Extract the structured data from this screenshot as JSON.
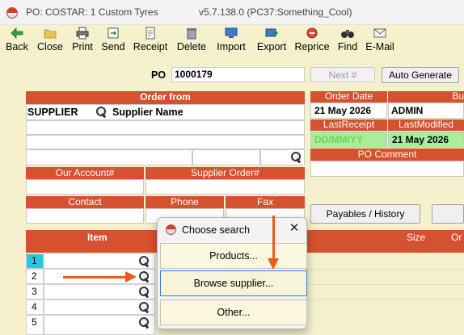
{
  "window": {
    "title": "PO: COSTAR:  1 Custom Tyres",
    "version": "v5.7.138.0  (PC37:Something_Cool)"
  },
  "toolbar": {
    "items": [
      {
        "label": "Back",
        "icon": "back-arrow-icon"
      },
      {
        "label": "Close",
        "icon": "folder-icon"
      },
      {
        "label": "Print",
        "icon": "printer-icon"
      },
      {
        "label": "Send",
        "icon": "send-icon"
      },
      {
        "label": "Receipt",
        "icon": "receipt-icon"
      },
      {
        "label": "Delete",
        "icon": "trash-icon"
      },
      {
        "label": "Import",
        "icon": "import-icon"
      },
      {
        "label": "Export",
        "icon": "export-icon"
      },
      {
        "label": "Reprice",
        "icon": "reprice-icon"
      },
      {
        "label": "Find",
        "icon": "binoculars-icon"
      },
      {
        "label": "E-Mail",
        "icon": "email-icon"
      }
    ]
  },
  "po": {
    "label": "PO",
    "number": "1000179",
    "next_label": "Next #",
    "auto_generate_label": "Auto Generate"
  },
  "order_from": {
    "header": "Order from",
    "supplier_label": "SUPPLIER",
    "supplier_name_label": "Supplier Name",
    "our_account_label": "Our Account#",
    "supplier_order_label": "Supplier Order#",
    "contact_label": "Contact",
    "phone_label": "Phone",
    "fax_label": "Fax"
  },
  "order_info": {
    "order_date_label": "Order Date",
    "order_date": "21 May 2026",
    "buyer_label": "Bu",
    "buyer": "ADMIN",
    "last_receipt_label": "LastReceipt",
    "last_receipt": "DD/MM/YY",
    "last_modified_label": "LastModified",
    "last_modified": "21 May 2026",
    "po_comment_label": "PO Comment"
  },
  "payables_label": "Payables / History",
  "grid": {
    "item_header": "Item",
    "size_header": "Size",
    "col_right_header": "Or",
    "rows": [
      "1",
      "2",
      "3",
      "4",
      "5"
    ]
  },
  "dialog": {
    "title": "Choose search",
    "close_glyph": "✕",
    "options": [
      "Products...",
      "Browse supplier...",
      "Other..."
    ]
  },
  "colors": {
    "accent": "#d6512f",
    "background": "#f6f1cd",
    "arrow": "#ea5b1b",
    "highlight_green": "#a8ee9a"
  }
}
